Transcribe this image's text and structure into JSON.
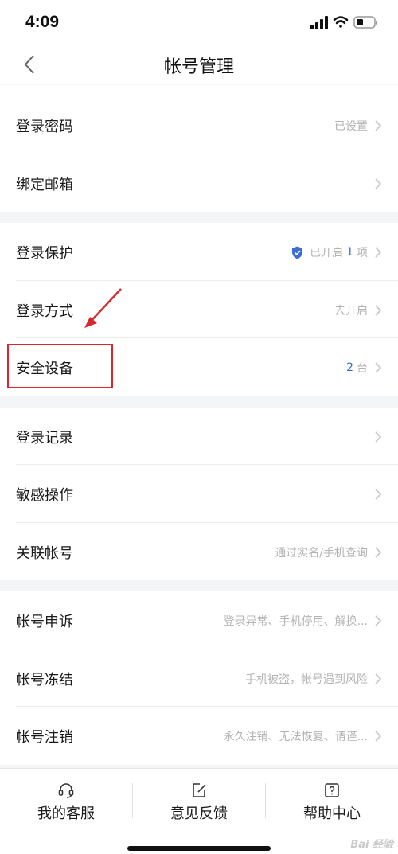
{
  "status_bar": {
    "time": "4:09"
  },
  "nav": {
    "title": "帐号管理"
  },
  "groups": [
    {
      "rows": [
        {
          "label": "登录密码",
          "value": "已设置"
        },
        {
          "label": "绑定邮箱",
          "value": ""
        }
      ]
    },
    {
      "rows": [
        {
          "label": "登录保护",
          "value_prefix": "已开启",
          "value_num": "1",
          "value_suffix": "项"
        },
        {
          "label": "登录方式",
          "value": "去开启"
        },
        {
          "label": "安全设备",
          "value_num": "2",
          "value_suffix": "台"
        }
      ]
    },
    {
      "rows": [
        {
          "label": "登录记录",
          "value": ""
        },
        {
          "label": "敏感操作",
          "value": ""
        },
        {
          "label": "关联帐号",
          "value": "通过实名/手机查询"
        }
      ]
    },
    {
      "rows": [
        {
          "label": "帐号申诉",
          "value": "登录异常、手机停用、解换..."
        },
        {
          "label": "帐号冻结",
          "value": "手机被盗，帐号遇到风险"
        },
        {
          "label": "帐号注销",
          "value": "永久注销、无法恢复、请谨..."
        }
      ]
    }
  ],
  "tabs": [
    {
      "label": "我的客服",
      "icon": "headset-icon"
    },
    {
      "label": "意见反馈",
      "icon": "edit-icon"
    },
    {
      "label": "帮助中心",
      "icon": "help-icon"
    }
  ],
  "colors": {
    "accent": "#3b6ed6",
    "highlight": "#d9272e"
  },
  "watermark": "Bai 经验"
}
